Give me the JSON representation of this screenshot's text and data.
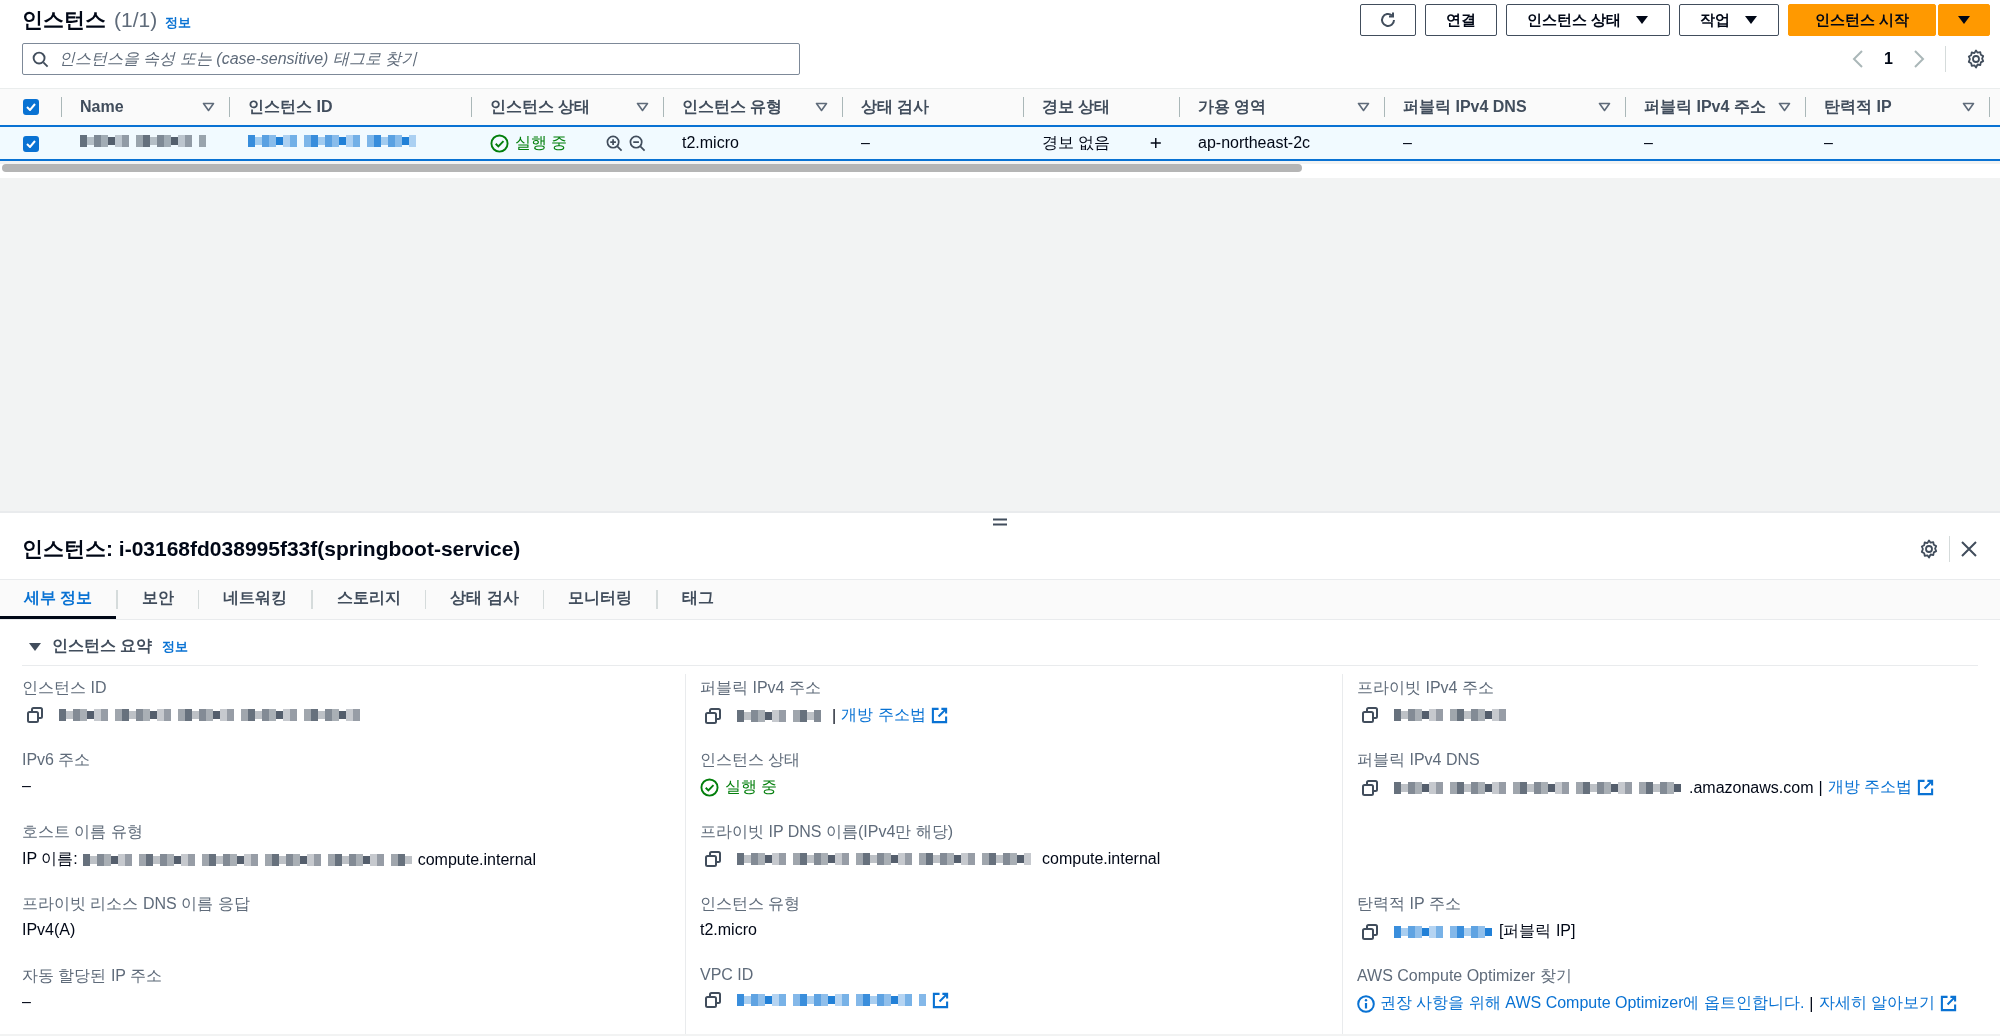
{
  "header": {
    "title": "인스턴스",
    "count": "(1/1)",
    "info_link": "정보"
  },
  "toolbar": {
    "buttons": [
      {
        "kind": "refresh"
      },
      {
        "kind": "normal",
        "label": "연결"
      },
      {
        "kind": "dropdown",
        "label": "인스턴스 상태"
      },
      {
        "kind": "dropdown",
        "label": "작업"
      },
      {
        "kind": "primary",
        "label": "인스턴스 시작"
      },
      {
        "kind": "primary-caret"
      }
    ]
  },
  "search": {
    "placeholder": "인스턴스을 속성 또는 (case-sensitive) 태그로 찾기"
  },
  "pagination": {
    "page": "1"
  },
  "table": {
    "select_all_checked": true,
    "columns": [
      {
        "label": "Name",
        "filter": true
      },
      {
        "label": "인스턴스 ID",
        "filter": false
      },
      {
        "label": "인스턴스 상태",
        "filter": true
      },
      {
        "label": "인스턴스 유형",
        "filter": true
      },
      {
        "label": "상태 검사",
        "filter": false
      },
      {
        "label": "경보 상태",
        "filter": false
      },
      {
        "label": "가용 영역",
        "filter": true
      },
      {
        "label": "퍼블릭 IPv4 DNS",
        "filter": true
      },
      {
        "label": "퍼블릭 IPv4 주소",
        "filter": true
      },
      {
        "label": "탄력적 IP",
        "filter": true
      }
    ],
    "rows": [
      {
        "selected": true,
        "cells": [
          {
            "kind": "redacted"
          },
          {
            "kind": "redacted-link"
          },
          {
            "kind": "status",
            "text": "실행 중"
          },
          {
            "kind": "text",
            "text": "t2.micro"
          },
          {
            "kind": "text",
            "text": "–"
          },
          {
            "kind": "alarm",
            "text": "경보 없음"
          },
          {
            "kind": "text",
            "text": "ap-northeast-2c"
          },
          {
            "kind": "text",
            "text": "–"
          },
          {
            "kind": "text",
            "text": "–"
          },
          {
            "kind": "text",
            "text": "–"
          }
        ]
      }
    ]
  },
  "details": {
    "title": "인스턴스: i-03168fd038995f33f(springboot-service)",
    "tabs": [
      {
        "label": "세부 정보",
        "selected": true
      },
      {
        "label": "보안",
        "selected": false
      },
      {
        "label": "네트워킹",
        "selected": false
      },
      {
        "label": "스토리지",
        "selected": false
      },
      {
        "label": "상태 검사",
        "selected": false
      },
      {
        "label": "모니터링",
        "selected": false
      },
      {
        "label": "태그",
        "selected": false
      }
    ],
    "section": {
      "title": "인스턴스 요약",
      "info_link": "정보",
      "expanded": true
    },
    "columns": [
      [
        {
          "label": "인스턴스 ID",
          "copy": true,
          "value": [
            {
              "kind": "redacted"
            }
          ]
        },
        {
          "label": "IPv6 주소",
          "copy": false,
          "value": [
            {
              "kind": "text",
              "text": "–"
            }
          ]
        },
        {
          "label": "호스트 이름 유형",
          "copy": false,
          "value": [
            {
              "kind": "text",
              "text": "IP 이름:"
            },
            {
              "kind": "redacted"
            },
            {
              "kind": "text",
              "text": "compute.internal"
            }
          ]
        },
        {
          "label": "프라이빗 리소스 DNS 이름 응답",
          "copy": false,
          "value": [
            {
              "kind": "text",
              "text": "IPv4(A)"
            }
          ]
        },
        {
          "label": "자동 할당된 IP 주소",
          "copy": false,
          "value": [
            {
              "kind": "text",
              "text": "–"
            }
          ]
        }
      ],
      [
        {
          "label": "퍼블릭 IPv4 주소",
          "copy": true,
          "value": [
            {
              "kind": "redacted"
            },
            {
              "kind": "text",
              "text": "|"
            },
            {
              "kind": "link",
              "text": "개방 주소법",
              "external": true
            }
          ]
        },
        {
          "label": "인스턴스 상태",
          "copy": false,
          "value": [
            {
              "kind": "status",
              "text": "실행 중"
            }
          ]
        },
        {
          "label": "프라이빗 IP DNS 이름(IPv4만 해당)",
          "copy": true,
          "value": [
            {
              "kind": "redacted"
            },
            {
              "kind": "text",
              "text": "compute.internal"
            }
          ]
        },
        {
          "label": "인스턴스 유형",
          "copy": false,
          "value": [
            {
              "kind": "text",
              "text": "t2.micro"
            }
          ]
        },
        {
          "label": "VPC ID",
          "copy": true,
          "value": [
            {
              "kind": "redacted-link"
            },
            {
              "kind": "link",
              "external": true
            }
          ]
        }
      ],
      [
        {
          "label": "프라이빗 IPv4 주소",
          "copy": true,
          "value": [
            {
              "kind": "redacted"
            }
          ]
        },
        {
          "label": "퍼블릭 IPv4 DNS",
          "copy": true,
          "value": [
            {
              "kind": "redacted"
            },
            {
              "kind": "text",
              "text": ".amazonaws.com"
            },
            {
              "kind": "text",
              "text": "|"
            },
            {
              "kind": "link",
              "text": "개방 주소법",
              "external": true
            }
          ]
        },
        null,
        {
          "label": "탄력적 IP 주소",
          "copy": true,
          "value": [
            {
              "kind": "redacted-link"
            },
            {
              "kind": "text",
              "text": "[퍼블릭 IP]"
            }
          ]
        },
        {
          "label": "AWS Compute Optimizer 찾기",
          "copy": false,
          "value": [
            {
              "kind": "info-link",
              "text": "권장 사항을 위해 AWS Compute Optimizer에 옵트인합니다."
            },
            {
              "kind": "text",
              "text": "|"
            },
            {
              "kind": "link",
              "text": "자세히 알아보기",
              "external": true
            }
          ]
        }
      ]
    ]
  }
}
